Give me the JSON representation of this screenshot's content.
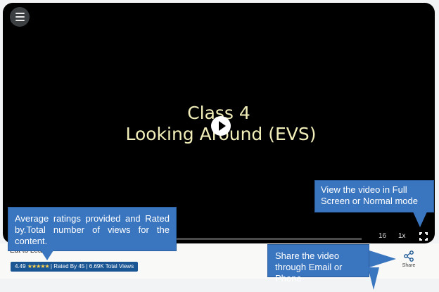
{
  "video": {
    "title_line1": "Class 4",
    "title_line2": "Looking Around (EVS)",
    "time_display": "16",
    "speed": "1x"
  },
  "content": {
    "title_partial": "Eat to Lea..."
  },
  "rating": {
    "value": "4.49",
    "stars": "★★★★★",
    "rated_by": "| Rated By 45",
    "views": "| 6.69K Total Views"
  },
  "share": {
    "label": "Share"
  },
  "callouts": {
    "fullscreen": "View the video in Full Screen or Normal mode",
    "rating": "Average ratings provided and Rated by.Total number of views for the content.",
    "share": "Share the video through Email or Phone"
  },
  "colors": {
    "callout": "#3a76c0",
    "rating_pill": "#1a5694",
    "title_text": "#f2eeb9"
  },
  "icons": [
    "menu-icon",
    "play-icon",
    "fullscreen-icon",
    "share-icon",
    "star-icon"
  ]
}
